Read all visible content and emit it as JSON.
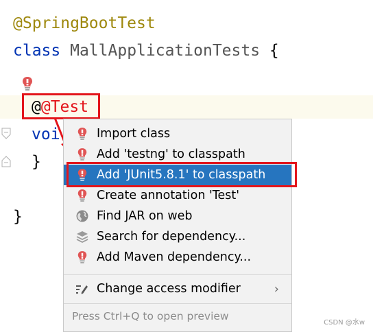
{
  "code": {
    "line1": "@SpringBootTest",
    "line2_keyword": "class",
    "line2_name": "MallApplicationTests",
    "line2_brace": "{",
    "line3_annotation": "@Test",
    "line4": "voi",
    "line5": "}",
    "line6": "}"
  },
  "popup": {
    "items": [
      {
        "label": "Import class",
        "icon": "bulb-icon"
      },
      {
        "label": "Add 'testng' to classpath",
        "icon": "bulb-icon"
      },
      {
        "label": "Add 'JUnit5.8.1' to classpath",
        "icon": "bulb-icon"
      },
      {
        "label": "Create annotation 'Test'",
        "icon": "bulb-icon"
      },
      {
        "label": "Find JAR on web",
        "icon": "globe-icon"
      },
      {
        "label": "Search for dependency...",
        "icon": "layers-icon"
      },
      {
        "label": "Add Maven dependency...",
        "icon": "bulb-icon"
      }
    ],
    "change_access": "Change access modifier",
    "footer": "Press Ctrl+Q to open preview"
  },
  "watermark": "CSDN @水w",
  "colors": {
    "selection": "#2675bf",
    "annotation_box": "#e3151b",
    "keyword": "#0033b3",
    "annotation_text": "#9e880d"
  }
}
